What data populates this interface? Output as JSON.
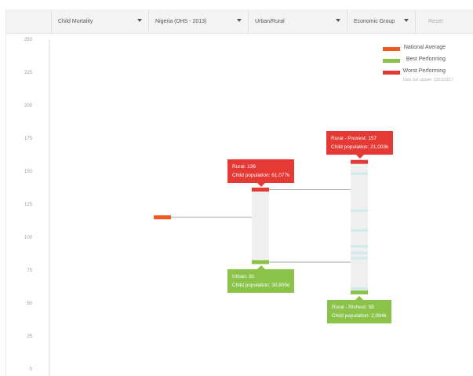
{
  "toolbar": {
    "filters": [
      {
        "label": "Child Mortality"
      },
      {
        "label": "Nigeria (DHS - 2013)"
      },
      {
        "label": "Urban/Rural"
      },
      {
        "label": "Economic Group"
      }
    ],
    "reset_label": "Reset"
  },
  "legend": {
    "items": [
      {
        "label": "National Average",
        "color": "#ee5a24"
      },
      {
        "label": "Best Performing",
        "color": "#8bc34a"
      },
      {
        "label": "Worst Performing",
        "color": "#e53935"
      }
    ],
    "updated_text": "Data last update: 03/03/2017"
  },
  "chart_data": {
    "type": "range",
    "ylim": [
      0,
      250
    ],
    "yticks": [
      0,
      25,
      50,
      75,
      100,
      125,
      150,
      175,
      200,
      225,
      250
    ],
    "grid": false,
    "legend_position": "top-right",
    "colors": {
      "national": "#ee5a24",
      "best": "#8bc34a",
      "worst": "#e53935",
      "range_fill": "#efefef",
      "inner_marker": "#cfe9ee"
    },
    "national_average": 115,
    "groups": [
      {
        "name": "Urban/Rural",
        "best": {
          "value": 81,
          "tooltip_title": "Urban: 81",
          "tooltip_pop": "Child population: 30,805k"
        },
        "worst": {
          "value": 136,
          "tooltip_title": "Rural: 136",
          "tooltip_pop": "Child population: 61,077k"
        },
        "inner": []
      },
      {
        "name": "Economic Group",
        "best": {
          "value": 58,
          "tooltip_title": "Rural - Richest: 58",
          "tooltip_pop": "Child population: 2,084k"
        },
        "worst": {
          "value": 157,
          "tooltip_title": "Rural - Poorest: 157",
          "tooltip_pop": "Child population: 21,003k"
        },
        "inner": [
          61,
          84,
          88,
          93,
          105,
          120,
          148
        ]
      }
    ]
  }
}
